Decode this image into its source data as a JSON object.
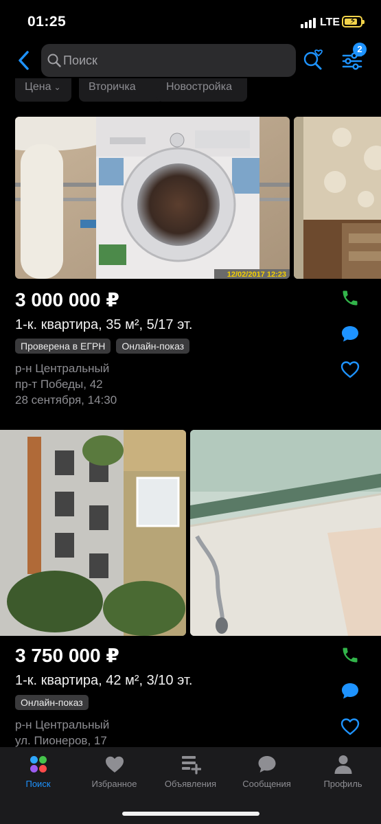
{
  "status_bar": {
    "time": "01:25",
    "network": "LTE"
  },
  "header": {
    "search_placeholder": "Поиск",
    "filters_badge": "2"
  },
  "chips": [
    {
      "label": "Цена"
    },
    {
      "label": "Вторичка"
    },
    {
      "label": "Новостройка"
    }
  ],
  "listings": [
    {
      "price": "3 000 000 ₽",
      "title": "1-к. квартира, 35 м², 5/17 эт.",
      "tags": [
        "Проверена в ЕГРН",
        "Онлайн-показ"
      ],
      "district": "р-н Центральный",
      "address": "пр-т Победы, 42",
      "date": "28 сентября, 14:30",
      "photo_stamp": "12/02/2017 12:23"
    },
    {
      "price": "3 750 000 ₽",
      "title": "1-к. квартира, 42 м², 3/10 эт.",
      "tags": [
        "Онлайн-показ"
      ],
      "district": "р-н Центральный",
      "address": "ул. Пионеров, 17"
    }
  ],
  "tabbar": {
    "tabs": [
      {
        "label": "Поиск",
        "icon": "search-dots-icon",
        "active": true
      },
      {
        "label": "Избранное",
        "icon": "heart-icon"
      },
      {
        "label": "Объявления",
        "icon": "post-ad-icon"
      },
      {
        "label": "Сообщения",
        "icon": "chat-bubble-icon"
      },
      {
        "label": "Профиль",
        "icon": "person-icon"
      }
    ]
  },
  "colors": {
    "accent": "#1e93ff",
    "call": "#32b44a",
    "background": "#000000",
    "battery": "#f2d34a"
  }
}
